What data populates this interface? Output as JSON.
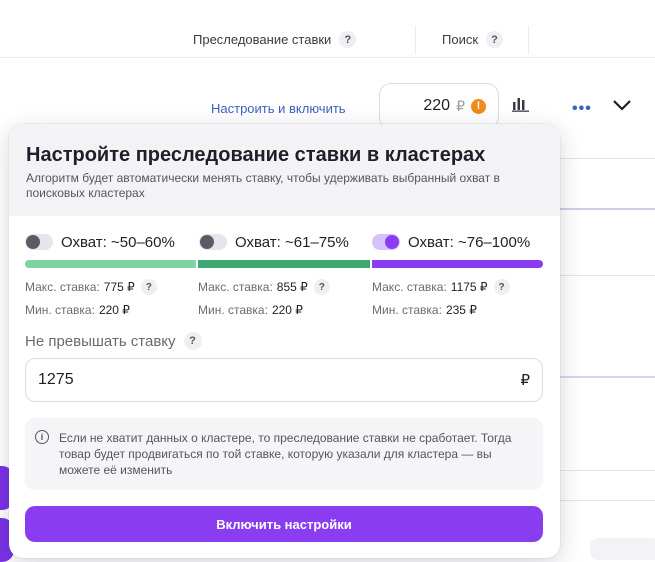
{
  "header": {
    "bid_tracking_label": "Преследование ставки",
    "search_label": "Поиск",
    "help_glyph": "?"
  },
  "row": {
    "configure_link": "Настроить и включить",
    "price_value": "220",
    "currency": "₽",
    "warning_glyph": "!",
    "more_glyph": "•••"
  },
  "popup": {
    "title": "Настройте преследование ставки в кластерах",
    "description": "Алгоритм будет автоматически менять ставку, чтобы удерживать выбранный охват в поисковых кластерах",
    "tiers": [
      {
        "label": "Охват: ~50–60%",
        "enabled": false,
        "color": "#7dd3a3",
        "max_label": "Макс. ставка:",
        "max_value": "775 ₽",
        "min_label": "Мин. ставка:",
        "min_value": "220 ₽"
      },
      {
        "label": "Охват: ~61–75%",
        "enabled": false,
        "color": "#3fa873",
        "max_label": "Макс. ставка:",
        "max_value": "855 ₽",
        "min_label": "Мин. ставка:",
        "min_value": "220 ₽"
      },
      {
        "label": "Охват: ~76–100%",
        "enabled": true,
        "color": "#8a3cf0",
        "max_label": "Макс. ставка:",
        "max_value": "1175 ₽",
        "min_label": "Мин. ставка:",
        "min_value": "235 ₽"
      }
    ],
    "limit_label": "Не превышать ставку",
    "limit_value": "1275",
    "limit_currency": "₽",
    "info_glyph": "i",
    "info_text": "Если не хватит данных о кластере, то преследование ставки не сработает. Тогда товар будет продвигаться по той ставке, которую указали для кластера — вы можете её изменить",
    "submit_label": "Включить настройки"
  },
  "colors": {
    "accent": "#8a3cf0",
    "link": "#3c5fc1",
    "warning": "#f08a1a"
  }
}
